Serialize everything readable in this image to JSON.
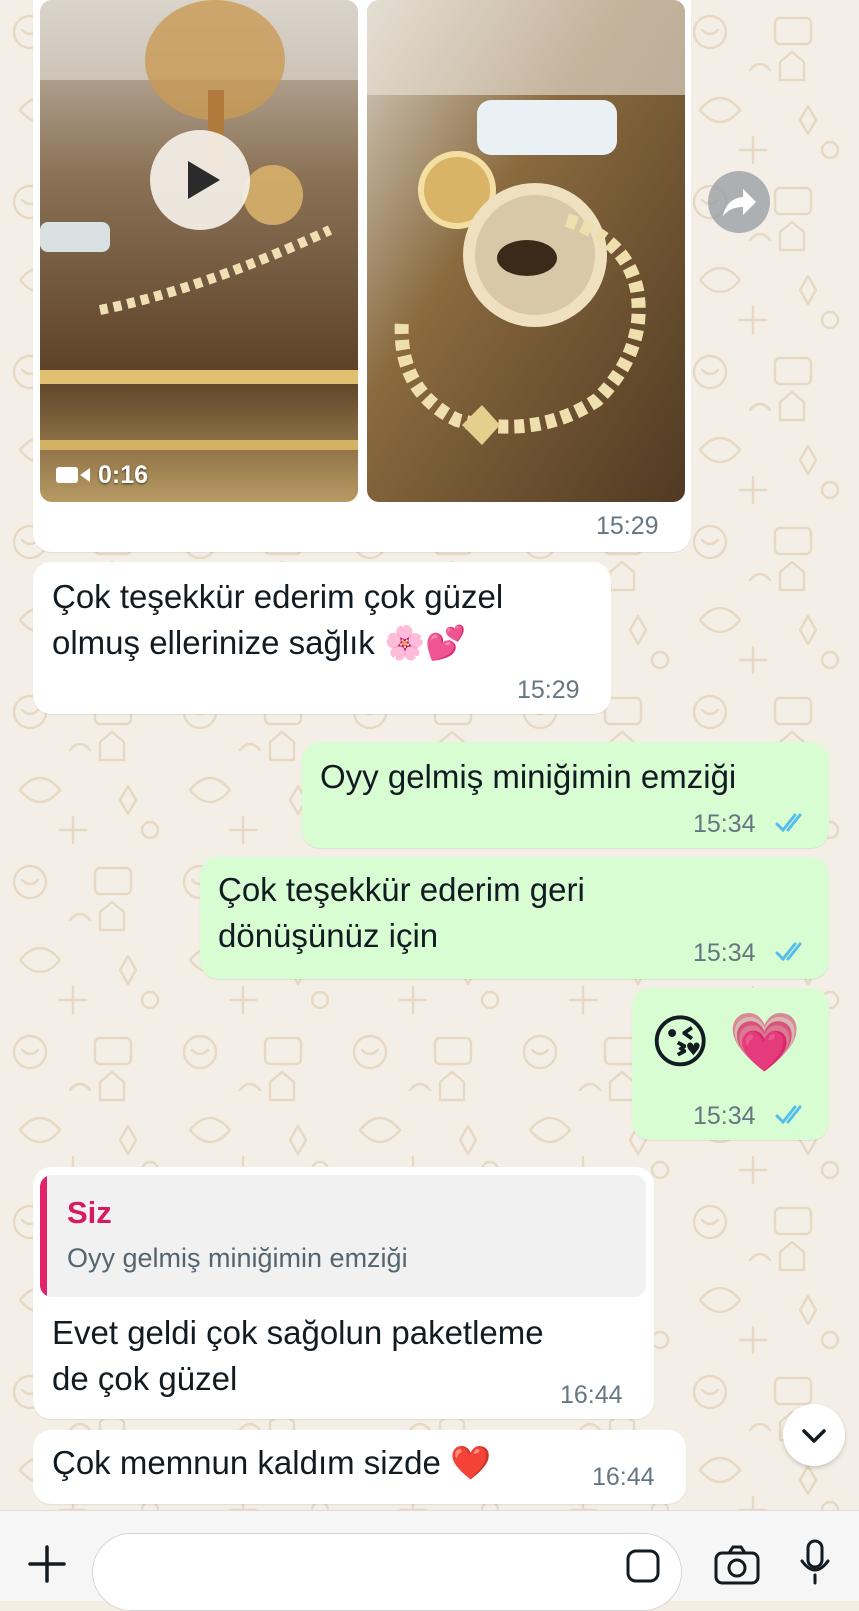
{
  "colors": {
    "incoming_bubble": "#ffffff",
    "outgoing_bubble": "#d9fdd3",
    "read_ticks": "#53bdeb",
    "quote_accent": "#e0236a",
    "chat_background": "#f4efe6"
  },
  "album": {
    "video_duration": "0:16",
    "time": "15:29",
    "icons": [
      "play-icon",
      "video-camera-icon",
      "forward-icon"
    ]
  },
  "messages": [
    {
      "id": "m1",
      "direction": "incoming",
      "text": "Çok teşekkür ederim çok güzel\nolmuş ellerinize sağlık 🌸💕",
      "time": "15:29"
    },
    {
      "id": "m2",
      "direction": "outgoing",
      "text": "Oyy gelmiş miniğimin emziği",
      "time": "15:34",
      "status": "read"
    },
    {
      "id": "m3",
      "direction": "outgoing",
      "text": "Çok teşekkür ederim geri\ndönüşünüz için",
      "time": "15:34",
      "status": "read"
    },
    {
      "id": "m4",
      "direction": "outgoing",
      "text": "😘 💗",
      "time": "15:34",
      "status": "read"
    },
    {
      "id": "m5",
      "direction": "incoming",
      "reply_to": {
        "author": "Siz",
        "text": "Oyy gelmiş miniğimin emziği"
      },
      "text": "Evet geldi çok sağolun paketleme\nde çok güzel",
      "time": "16:44"
    },
    {
      "id": "m6",
      "direction": "incoming",
      "text": "Çok memnun kaldım sizde ❤️",
      "time": "16:44"
    }
  ],
  "bottom_bar": {
    "icons": [
      "plus-icon",
      "sticker-icon",
      "camera-icon",
      "microphone-icon"
    ]
  },
  "scroll_button_icon": "chevron-down-icon"
}
